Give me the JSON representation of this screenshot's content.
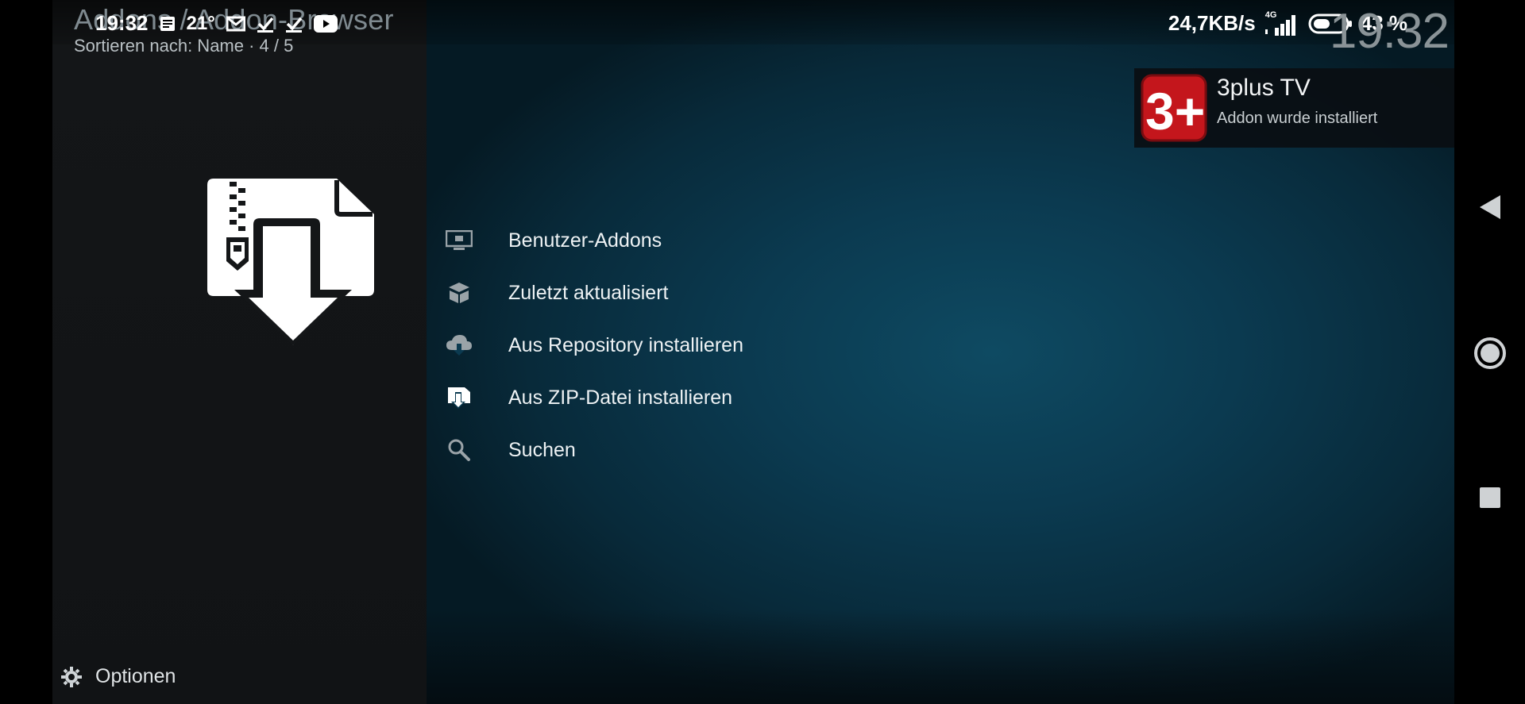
{
  "header": {
    "breadcrumb": "Addons / Addon-Browser",
    "sort_info": "Sortieren nach: Name  ·  4 / 5",
    "clock": "19:32"
  },
  "status_bar": {
    "time": "19:32",
    "temperature": "21°",
    "net_speed": "24,7KB/s",
    "network_type": "4G",
    "battery": "43 %"
  },
  "menu": {
    "items": [
      {
        "label": "Benutzer-Addons",
        "icon": "monitor-addon-icon"
      },
      {
        "label": "Zuletzt aktualisiert",
        "icon": "open-box-icon"
      },
      {
        "label": "Aus Repository installieren",
        "icon": "cloud-download-icon"
      },
      {
        "label": "Aus ZIP-Datei installieren",
        "icon": "zip-install-icon"
      },
      {
        "label": "Suchen",
        "icon": "search-icon"
      }
    ]
  },
  "footer": {
    "options_label": "Optionen"
  },
  "notification": {
    "title": "3plus TV",
    "message": "Addon wurde installiert",
    "logo_text": "3+",
    "accent": "#c4161c"
  },
  "colors": {
    "background_left": "#131517",
    "background_right": "#0b3a50",
    "text_primary": "#eef2f4",
    "text_dim": "#7f8a90"
  }
}
